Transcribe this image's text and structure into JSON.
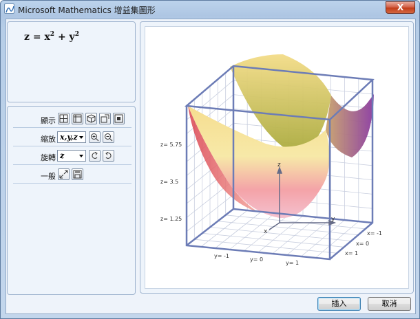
{
  "window": {
    "title": "Microsoft Mathematics 增益集圖形",
    "close_glyph": "X"
  },
  "formula": {
    "lhs": "z",
    "eq": "=",
    "t1": "x",
    "p1": "2",
    "plus": "+",
    "t2": "y",
    "p2": "2"
  },
  "controls": {
    "display": {
      "label": "顯示",
      "icons": [
        "grid-icon",
        "axes-box-icon",
        "cube-icon",
        "aspect-icon",
        "fit-icon"
      ]
    },
    "zoom": {
      "label": "縮放",
      "axis_value": "x,y,z",
      "icons": [
        "zoom-in-icon",
        "zoom-out-icon"
      ]
    },
    "rotate": {
      "label": "旋轉",
      "axis_value": "z",
      "icons": [
        "rotate-ccw-icon",
        "rotate-cw-icon"
      ]
    },
    "general": {
      "label": "一般",
      "icons": [
        "resize-icon",
        "save-icon"
      ]
    }
  },
  "chart_data": {
    "type": "surface",
    "function": "z = x^2 + y^2",
    "x_ticks": [
      "x= -1",
      "x= 0",
      "x= 1"
    ],
    "y_ticks": [
      "y= -1",
      "y= 0",
      "y= 1"
    ],
    "z_ticks": [
      "z= 1.25",
      "z= 3.5",
      "z= 5.75"
    ],
    "axis_letters": {
      "x": "x",
      "y": "y",
      "z": "z"
    },
    "grid": true,
    "colors": {
      "box": "#6c7cb6",
      "surface_low": "#f07a8a",
      "surface_high": "#f5d98a"
    }
  },
  "buttons": {
    "insert": "插入",
    "cancel": "取消"
  }
}
